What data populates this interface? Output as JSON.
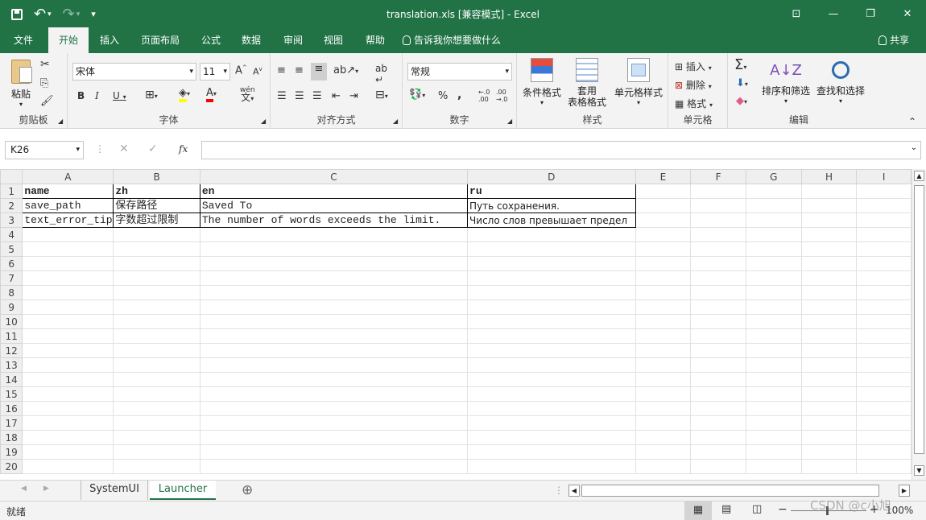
{
  "window": {
    "title": "translation.xls  [兼容模式]  -  Excel",
    "minimize": "—",
    "restore": "❐",
    "close": "✕",
    "ribbon_display": "⊡"
  },
  "qat": {
    "save": "💾",
    "undo": "↶",
    "redo": "↷",
    "customize": "▾"
  },
  "tabs": [
    {
      "label": "文件"
    },
    {
      "label": "开始"
    },
    {
      "label": "插入"
    },
    {
      "label": "页面布局"
    },
    {
      "label": "公式"
    },
    {
      "label": "数据"
    },
    {
      "label": "审阅"
    },
    {
      "label": "视图"
    },
    {
      "label": "帮助"
    }
  ],
  "tell_me": "告诉我你想要做什么",
  "share": "共享",
  "ribbon": {
    "clipboard": {
      "label": "剪贴板",
      "paste": "粘贴"
    },
    "font": {
      "label": "字体",
      "name": "宋体",
      "size": "11",
      "bold": "B",
      "italic": "I",
      "underline": "U",
      "grow": "A",
      "shrink": "A",
      "wen": "wén"
    },
    "alignment": {
      "label": "对齐方式",
      "wrap": "ab"
    },
    "number": {
      "label": "数字",
      "format": "常规",
      "percent": "%",
      "comma": ","
    },
    "styles": {
      "label": "样式",
      "cond": "条件格式",
      "table1": "套用",
      "table2": "表格格式",
      "cell": "单元格样式"
    },
    "cells": {
      "label": "单元格",
      "insert": "插入",
      "delete": "删除",
      "format": "格式"
    },
    "editing": {
      "label": "编辑",
      "sortfilter": "排序和筛选",
      "findselect": "查找和选择"
    }
  },
  "formula_bar": {
    "namebox": "K26",
    "fx": "fx",
    "value": ""
  },
  "sheet": {
    "columns": [
      "A",
      "B",
      "C",
      "D",
      "E",
      "F",
      "G",
      "H",
      "I"
    ],
    "rows": [
      [
        "name",
        "zh",
        "en",
        "ru"
      ],
      [
        "save_path",
        "保存路径",
        "Saved To",
        "Путь сохранения."
      ],
      [
        "text_error_tip",
        "字数超过限制",
        "The number of words exceeds the limit.",
        "Число слов превышает предел"
      ]
    ],
    "row_numbers": [
      "1",
      "2",
      "3",
      "4",
      "5",
      "6",
      "7",
      "8",
      "9",
      "10",
      "11",
      "12",
      "13",
      "14",
      "15",
      "16",
      "17",
      "18",
      "19",
      "20"
    ]
  },
  "sheet_tabs": [
    {
      "label": "SystemUI"
    },
    {
      "label": "Launcher"
    }
  ],
  "add_sheet": "⊕",
  "status": {
    "ready": "就绪",
    "zoom": "100%",
    "watermark": "CSDN @c小旭"
  }
}
